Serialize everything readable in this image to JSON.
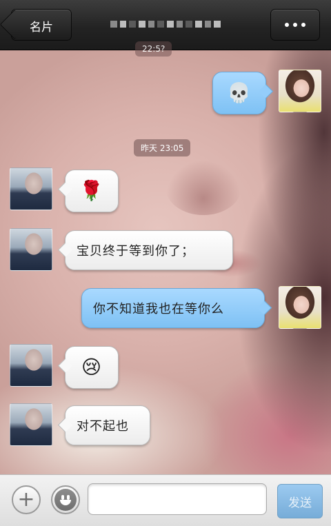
{
  "header": {
    "back_label": "名片",
    "title": "",
    "more_icon": "more-dots-icon"
  },
  "timestamps": {
    "top_partial": "22:5?",
    "yesterday": "昨天 23:05"
  },
  "messages": [
    {
      "side": "right",
      "kind": "emoji",
      "content": "💀",
      "icon": "skull-icon"
    },
    {
      "side": "left",
      "kind": "emoji",
      "content": "🌹",
      "icon": "rose-icon"
    },
    {
      "side": "left",
      "kind": "text",
      "content": "宝贝终于等到你了；"
    },
    {
      "side": "right",
      "kind": "text",
      "content": "你不知道我也在等你么"
    },
    {
      "side": "left",
      "kind": "emoji",
      "content": "😢",
      "icon": "crying-face-icon"
    },
    {
      "side": "left",
      "kind": "text",
      "content": "对不起也"
    }
  ],
  "input_bar": {
    "plus_icon": "plus-icon",
    "emoji_icon": "smiley-icon",
    "input_value": "",
    "input_placeholder": "",
    "send_label": "发送"
  },
  "colors": {
    "header_bg": "#1b1b1b",
    "outgoing_bubble": "#8fcbf7",
    "incoming_bubble": "#f4f4f4",
    "send_button": "#86b9e2"
  }
}
